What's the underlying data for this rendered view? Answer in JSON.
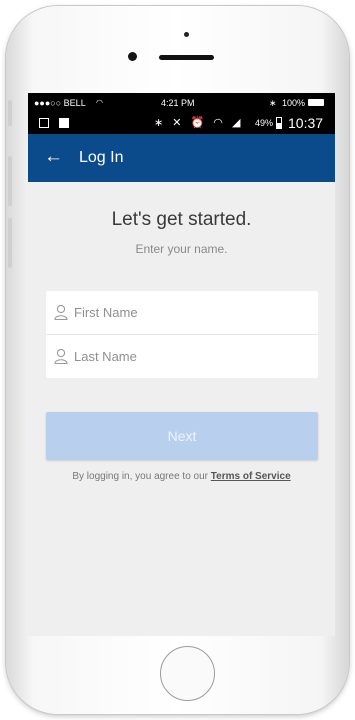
{
  "ios_status": {
    "carrier": "●●●○○ BELL",
    "time": "4:21 PM",
    "battery": "100%"
  },
  "android_status": {
    "battery": "49%",
    "time": "10:37"
  },
  "appbar": {
    "back_icon": "arrow-left-icon",
    "title": "Log In"
  },
  "main": {
    "heading": "Let's get started.",
    "subheading": "Enter your name.",
    "first_name_placeholder": "First Name",
    "last_name_placeholder": "Last Name",
    "first_name_value": "",
    "last_name_value": "",
    "next_label": "Next",
    "tos_prefix": "By logging in, you agree to our",
    "tos_link": "Terms of Service"
  },
  "colors": {
    "appbar": "#0b4a8b",
    "next_button": "#b8cfee",
    "background": "#efefef"
  }
}
